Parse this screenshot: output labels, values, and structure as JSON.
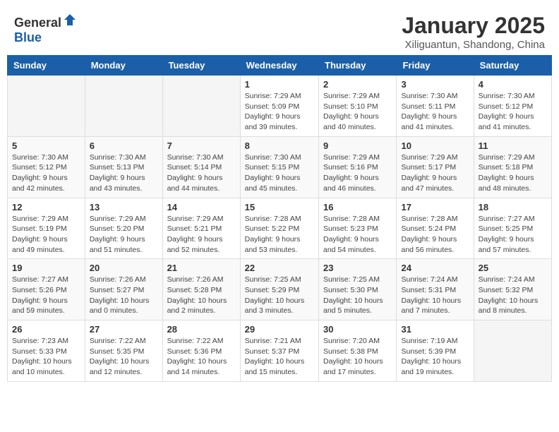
{
  "header": {
    "logo_general": "General",
    "logo_blue": "Blue",
    "title": "January 2025",
    "subtitle": "Xiliguantun, Shandong, China"
  },
  "weekdays": [
    "Sunday",
    "Monday",
    "Tuesday",
    "Wednesday",
    "Thursday",
    "Friday",
    "Saturday"
  ],
  "weeks": [
    [
      {
        "day": "",
        "info": ""
      },
      {
        "day": "",
        "info": ""
      },
      {
        "day": "",
        "info": ""
      },
      {
        "day": "1",
        "info": "Sunrise: 7:29 AM\nSunset: 5:09 PM\nDaylight: 9 hours\nand 39 minutes."
      },
      {
        "day": "2",
        "info": "Sunrise: 7:29 AM\nSunset: 5:10 PM\nDaylight: 9 hours\nand 40 minutes."
      },
      {
        "day": "3",
        "info": "Sunrise: 7:30 AM\nSunset: 5:11 PM\nDaylight: 9 hours\nand 41 minutes."
      },
      {
        "day": "4",
        "info": "Sunrise: 7:30 AM\nSunset: 5:12 PM\nDaylight: 9 hours\nand 41 minutes."
      }
    ],
    [
      {
        "day": "5",
        "info": "Sunrise: 7:30 AM\nSunset: 5:12 PM\nDaylight: 9 hours\nand 42 minutes."
      },
      {
        "day": "6",
        "info": "Sunrise: 7:30 AM\nSunset: 5:13 PM\nDaylight: 9 hours\nand 43 minutes."
      },
      {
        "day": "7",
        "info": "Sunrise: 7:30 AM\nSunset: 5:14 PM\nDaylight: 9 hours\nand 44 minutes."
      },
      {
        "day": "8",
        "info": "Sunrise: 7:30 AM\nSunset: 5:15 PM\nDaylight: 9 hours\nand 45 minutes."
      },
      {
        "day": "9",
        "info": "Sunrise: 7:29 AM\nSunset: 5:16 PM\nDaylight: 9 hours\nand 46 minutes."
      },
      {
        "day": "10",
        "info": "Sunrise: 7:29 AM\nSunset: 5:17 PM\nDaylight: 9 hours\nand 47 minutes."
      },
      {
        "day": "11",
        "info": "Sunrise: 7:29 AM\nSunset: 5:18 PM\nDaylight: 9 hours\nand 48 minutes."
      }
    ],
    [
      {
        "day": "12",
        "info": "Sunrise: 7:29 AM\nSunset: 5:19 PM\nDaylight: 9 hours\nand 49 minutes."
      },
      {
        "day": "13",
        "info": "Sunrise: 7:29 AM\nSunset: 5:20 PM\nDaylight: 9 hours\nand 51 minutes."
      },
      {
        "day": "14",
        "info": "Sunrise: 7:29 AM\nSunset: 5:21 PM\nDaylight: 9 hours\nand 52 minutes."
      },
      {
        "day": "15",
        "info": "Sunrise: 7:28 AM\nSunset: 5:22 PM\nDaylight: 9 hours\nand 53 minutes."
      },
      {
        "day": "16",
        "info": "Sunrise: 7:28 AM\nSunset: 5:23 PM\nDaylight: 9 hours\nand 54 minutes."
      },
      {
        "day": "17",
        "info": "Sunrise: 7:28 AM\nSunset: 5:24 PM\nDaylight: 9 hours\nand 56 minutes."
      },
      {
        "day": "18",
        "info": "Sunrise: 7:27 AM\nSunset: 5:25 PM\nDaylight: 9 hours\nand 57 minutes."
      }
    ],
    [
      {
        "day": "19",
        "info": "Sunrise: 7:27 AM\nSunset: 5:26 PM\nDaylight: 9 hours\nand 59 minutes."
      },
      {
        "day": "20",
        "info": "Sunrise: 7:26 AM\nSunset: 5:27 PM\nDaylight: 10 hours\nand 0 minutes."
      },
      {
        "day": "21",
        "info": "Sunrise: 7:26 AM\nSunset: 5:28 PM\nDaylight: 10 hours\nand 2 minutes."
      },
      {
        "day": "22",
        "info": "Sunrise: 7:25 AM\nSunset: 5:29 PM\nDaylight: 10 hours\nand 3 minutes."
      },
      {
        "day": "23",
        "info": "Sunrise: 7:25 AM\nSunset: 5:30 PM\nDaylight: 10 hours\nand 5 minutes."
      },
      {
        "day": "24",
        "info": "Sunrise: 7:24 AM\nSunset: 5:31 PM\nDaylight: 10 hours\nand 7 minutes."
      },
      {
        "day": "25",
        "info": "Sunrise: 7:24 AM\nSunset: 5:32 PM\nDaylight: 10 hours\nand 8 minutes."
      }
    ],
    [
      {
        "day": "26",
        "info": "Sunrise: 7:23 AM\nSunset: 5:33 PM\nDaylight: 10 hours\nand 10 minutes."
      },
      {
        "day": "27",
        "info": "Sunrise: 7:22 AM\nSunset: 5:35 PM\nDaylight: 10 hours\nand 12 minutes."
      },
      {
        "day": "28",
        "info": "Sunrise: 7:22 AM\nSunset: 5:36 PM\nDaylight: 10 hours\nand 14 minutes."
      },
      {
        "day": "29",
        "info": "Sunrise: 7:21 AM\nSunset: 5:37 PM\nDaylight: 10 hours\nand 15 minutes."
      },
      {
        "day": "30",
        "info": "Sunrise: 7:20 AM\nSunset: 5:38 PM\nDaylight: 10 hours\nand 17 minutes."
      },
      {
        "day": "31",
        "info": "Sunrise: 7:19 AM\nSunset: 5:39 PM\nDaylight: 10 hours\nand 19 minutes."
      },
      {
        "day": "",
        "info": ""
      }
    ]
  ]
}
